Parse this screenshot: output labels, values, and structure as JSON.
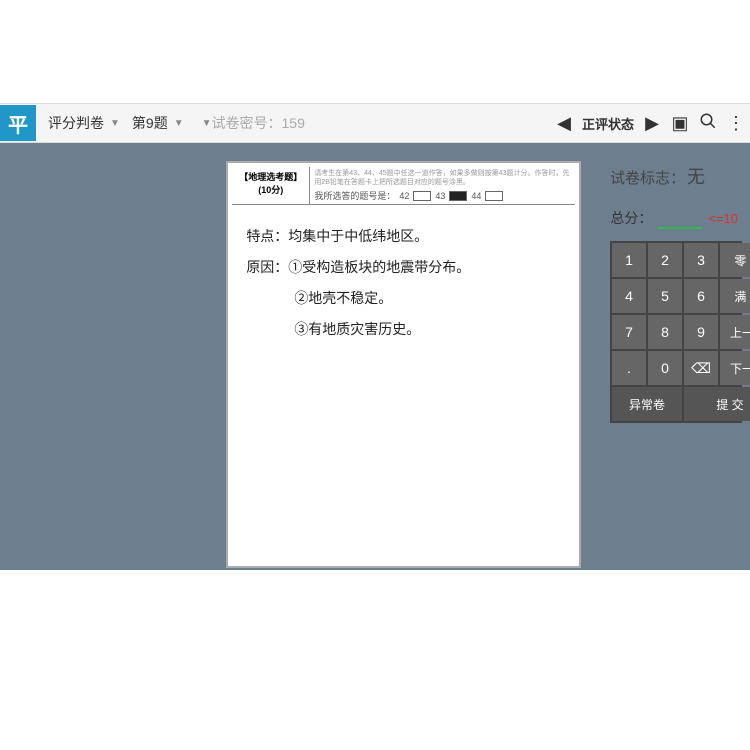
{
  "toolbar": {
    "logo": "平",
    "app_label": "评分判卷",
    "question_label": "第9题",
    "secret_label": "试卷密号：159",
    "status_label": "正评状态"
  },
  "paper": {
    "title_line1": "【地理选考题】",
    "title_line2": "(10分)",
    "instructions": "请考生在第43、44、45题中任选一道作答，如果多做则按第43题计分。作答时，先用2B铅笔在答题卡上把所选题目对应的题号涂黑。",
    "answer_label": "我所选答的题号是：",
    "opt1": "42",
    "opt2": "43",
    "opt3": "44",
    "hw1": "特点：均集中于中低纬地区。",
    "hw2": "原因：①受构造板块的地震带分布。",
    "hw3": "②地壳不稳定。",
    "hw4": "③有地质灾害历史。"
  },
  "panel": {
    "mark_label": "试卷标志：",
    "mark_value": "无",
    "total_label": "总分：",
    "max_label": "<=10"
  },
  "keys": {
    "k1": "1",
    "k2": "2",
    "k3": "3",
    "zero": "零 分",
    "k4": "4",
    "k5": "5",
    "k6": "6",
    "full": "满 分",
    "k7": "7",
    "k8": "8",
    "k9": "9",
    "prev": "上一题",
    "dot": ".",
    "k0": "0",
    "bk": "⌫",
    "next": "下一题",
    "abn": "异常卷",
    "submit": "提 交"
  }
}
